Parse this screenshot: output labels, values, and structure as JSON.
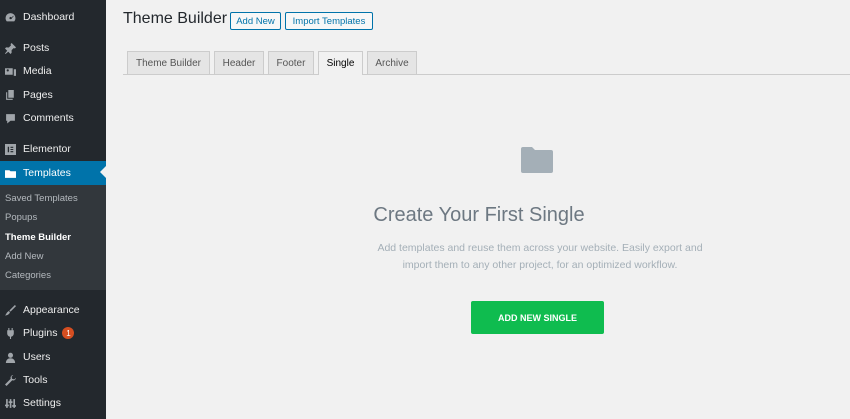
{
  "sidebar": {
    "items": [
      {
        "label": "Dashboard",
        "icon": "dashboard-icon"
      },
      {
        "label": "Posts",
        "icon": "pin-icon"
      },
      {
        "label": "Media",
        "icon": "media-icon"
      },
      {
        "label": "Pages",
        "icon": "pages-icon"
      },
      {
        "label": "Comments",
        "icon": "comment-icon"
      },
      {
        "label": "Elementor",
        "icon": "elementor-icon"
      },
      {
        "label": "Templates",
        "icon": "folder-icon"
      },
      {
        "label": "Appearance",
        "icon": "brush-icon"
      },
      {
        "label": "Plugins",
        "icon": "plugin-icon",
        "badge": "1"
      },
      {
        "label": "Users",
        "icon": "user-icon"
      },
      {
        "label": "Tools",
        "icon": "wrench-icon"
      },
      {
        "label": "Settings",
        "icon": "settings-icon"
      }
    ],
    "submenu": [
      "Saved Templates",
      "Popups",
      "Theme Builder",
      "Add New",
      "Categories"
    ],
    "active_item": "Templates",
    "current_submenu": "Theme Builder"
  },
  "header": {
    "title": "Theme Builder",
    "add_new_label": "Add New",
    "import_label": "Import Templates"
  },
  "tabs": [
    {
      "label": "Theme Builder"
    },
    {
      "label": "Header"
    },
    {
      "label": "Footer"
    },
    {
      "label": "Single"
    },
    {
      "label": "Archive"
    }
  ],
  "active_tab": "Single",
  "empty_state": {
    "icon": "folder-icon",
    "title": "Create Your First Single",
    "description_line1": "Add templates and reuse them across your website. Easily export and",
    "description_line2": "import them to any other project, for an optimized workflow.",
    "button_label": "ADD NEW SINGLE"
  },
  "colors": {
    "sidebar_bg": "#23282d",
    "active_menu": "#0073aa",
    "primary_button": "#0fbc4f",
    "badge": "#d54e21"
  }
}
